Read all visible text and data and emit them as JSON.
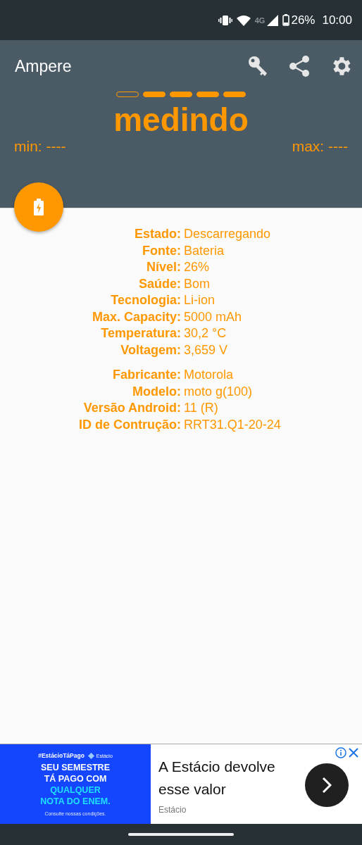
{
  "status_bar": {
    "network": "4G",
    "battery": "26%",
    "time": "10:00"
  },
  "app_bar": {
    "title": "Ampere"
  },
  "progress": [
    {
      "filled": false
    },
    {
      "filled": true
    },
    {
      "filled": true
    },
    {
      "filled": true
    },
    {
      "filled": true
    }
  ],
  "reading": "medindo",
  "min": "min: ----",
  "max": "max: ----",
  "info_groups": [
    [
      {
        "label": "Estado:",
        "value": "Descarregando"
      },
      {
        "label": "Fonte:",
        "value": "Bateria"
      },
      {
        "label": "Nível:",
        "value": "26%"
      },
      {
        "label": "Saúde:",
        "value": "Bom"
      },
      {
        "label": "Tecnologia:",
        "value": "Li-ion"
      },
      {
        "label": "Max. Capacity:",
        "value": "5000 mAh"
      },
      {
        "label": "Temperatura:",
        "value": "30,2 °C"
      },
      {
        "label": "Voltagem:",
        "value": "3,659 V"
      }
    ],
    [
      {
        "label": "Fabricante:",
        "value": "Motorola"
      },
      {
        "label": "Modelo:",
        "value": "moto g(100)"
      },
      {
        "label": "Versão Android:",
        "value": "11 (R)"
      },
      {
        "label": "ID de Contrução:",
        "value": "RRT31.Q1-20-24"
      }
    ]
  ],
  "ad": {
    "banner": {
      "hashtag": "#EstácioTáPago",
      "brand": "Estácio",
      "lines": [
        {
          "text": "SEU SEMESTRE",
          "highlight": false
        },
        {
          "text": "TÁ PAGO COM",
          "highlight": false
        },
        {
          "text": "QUALQUER",
          "highlight": true
        },
        {
          "text": "NOTA DO ENEM.",
          "highlight": true
        }
      ],
      "fine_print": "Consulte nossas condições."
    },
    "headline": "A Estácio devolve esse valor",
    "advertiser": "Estácio"
  }
}
